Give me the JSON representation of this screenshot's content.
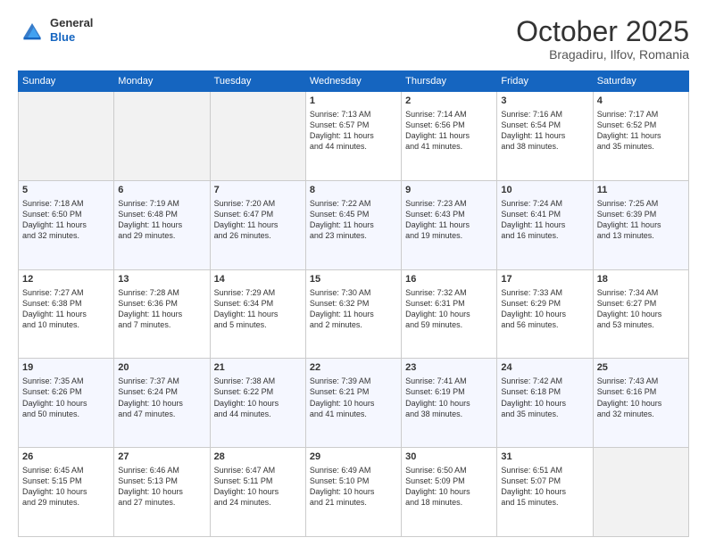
{
  "header": {
    "logo": {
      "line1": "General",
      "line2": "Blue"
    },
    "title": "October 2025",
    "location": "Bragadiru, Ilfov, Romania"
  },
  "days_of_week": [
    "Sunday",
    "Monday",
    "Tuesday",
    "Wednesday",
    "Thursday",
    "Friday",
    "Saturday"
  ],
  "weeks": [
    [
      {
        "day": "",
        "info": ""
      },
      {
        "day": "",
        "info": ""
      },
      {
        "day": "",
        "info": ""
      },
      {
        "day": "1",
        "info": "Sunrise: 7:13 AM\nSunset: 6:57 PM\nDaylight: 11 hours\nand 44 minutes."
      },
      {
        "day": "2",
        "info": "Sunrise: 7:14 AM\nSunset: 6:56 PM\nDaylight: 11 hours\nand 41 minutes."
      },
      {
        "day": "3",
        "info": "Sunrise: 7:16 AM\nSunset: 6:54 PM\nDaylight: 11 hours\nand 38 minutes."
      },
      {
        "day": "4",
        "info": "Sunrise: 7:17 AM\nSunset: 6:52 PM\nDaylight: 11 hours\nand 35 minutes."
      }
    ],
    [
      {
        "day": "5",
        "info": "Sunrise: 7:18 AM\nSunset: 6:50 PM\nDaylight: 11 hours\nand 32 minutes."
      },
      {
        "day": "6",
        "info": "Sunrise: 7:19 AM\nSunset: 6:48 PM\nDaylight: 11 hours\nand 29 minutes."
      },
      {
        "day": "7",
        "info": "Sunrise: 7:20 AM\nSunset: 6:47 PM\nDaylight: 11 hours\nand 26 minutes."
      },
      {
        "day": "8",
        "info": "Sunrise: 7:22 AM\nSunset: 6:45 PM\nDaylight: 11 hours\nand 23 minutes."
      },
      {
        "day": "9",
        "info": "Sunrise: 7:23 AM\nSunset: 6:43 PM\nDaylight: 11 hours\nand 19 minutes."
      },
      {
        "day": "10",
        "info": "Sunrise: 7:24 AM\nSunset: 6:41 PM\nDaylight: 11 hours\nand 16 minutes."
      },
      {
        "day": "11",
        "info": "Sunrise: 7:25 AM\nSunset: 6:39 PM\nDaylight: 11 hours\nand 13 minutes."
      }
    ],
    [
      {
        "day": "12",
        "info": "Sunrise: 7:27 AM\nSunset: 6:38 PM\nDaylight: 11 hours\nand 10 minutes."
      },
      {
        "day": "13",
        "info": "Sunrise: 7:28 AM\nSunset: 6:36 PM\nDaylight: 11 hours\nand 7 minutes."
      },
      {
        "day": "14",
        "info": "Sunrise: 7:29 AM\nSunset: 6:34 PM\nDaylight: 11 hours\nand 5 minutes."
      },
      {
        "day": "15",
        "info": "Sunrise: 7:30 AM\nSunset: 6:32 PM\nDaylight: 11 hours\nand 2 minutes."
      },
      {
        "day": "16",
        "info": "Sunrise: 7:32 AM\nSunset: 6:31 PM\nDaylight: 10 hours\nand 59 minutes."
      },
      {
        "day": "17",
        "info": "Sunrise: 7:33 AM\nSunset: 6:29 PM\nDaylight: 10 hours\nand 56 minutes."
      },
      {
        "day": "18",
        "info": "Sunrise: 7:34 AM\nSunset: 6:27 PM\nDaylight: 10 hours\nand 53 minutes."
      }
    ],
    [
      {
        "day": "19",
        "info": "Sunrise: 7:35 AM\nSunset: 6:26 PM\nDaylight: 10 hours\nand 50 minutes."
      },
      {
        "day": "20",
        "info": "Sunrise: 7:37 AM\nSunset: 6:24 PM\nDaylight: 10 hours\nand 47 minutes."
      },
      {
        "day": "21",
        "info": "Sunrise: 7:38 AM\nSunset: 6:22 PM\nDaylight: 10 hours\nand 44 minutes."
      },
      {
        "day": "22",
        "info": "Sunrise: 7:39 AM\nSunset: 6:21 PM\nDaylight: 10 hours\nand 41 minutes."
      },
      {
        "day": "23",
        "info": "Sunrise: 7:41 AM\nSunset: 6:19 PM\nDaylight: 10 hours\nand 38 minutes."
      },
      {
        "day": "24",
        "info": "Sunrise: 7:42 AM\nSunset: 6:18 PM\nDaylight: 10 hours\nand 35 minutes."
      },
      {
        "day": "25",
        "info": "Sunrise: 7:43 AM\nSunset: 6:16 PM\nDaylight: 10 hours\nand 32 minutes."
      }
    ],
    [
      {
        "day": "26",
        "info": "Sunrise: 6:45 AM\nSunset: 5:15 PM\nDaylight: 10 hours\nand 29 minutes."
      },
      {
        "day": "27",
        "info": "Sunrise: 6:46 AM\nSunset: 5:13 PM\nDaylight: 10 hours\nand 27 minutes."
      },
      {
        "day": "28",
        "info": "Sunrise: 6:47 AM\nSunset: 5:11 PM\nDaylight: 10 hours\nand 24 minutes."
      },
      {
        "day": "29",
        "info": "Sunrise: 6:49 AM\nSunset: 5:10 PM\nDaylight: 10 hours\nand 21 minutes."
      },
      {
        "day": "30",
        "info": "Sunrise: 6:50 AM\nSunset: 5:09 PM\nDaylight: 10 hours\nand 18 minutes."
      },
      {
        "day": "31",
        "info": "Sunrise: 6:51 AM\nSunset: 5:07 PM\nDaylight: 10 hours\nand 15 minutes."
      },
      {
        "day": "",
        "info": ""
      }
    ]
  ]
}
